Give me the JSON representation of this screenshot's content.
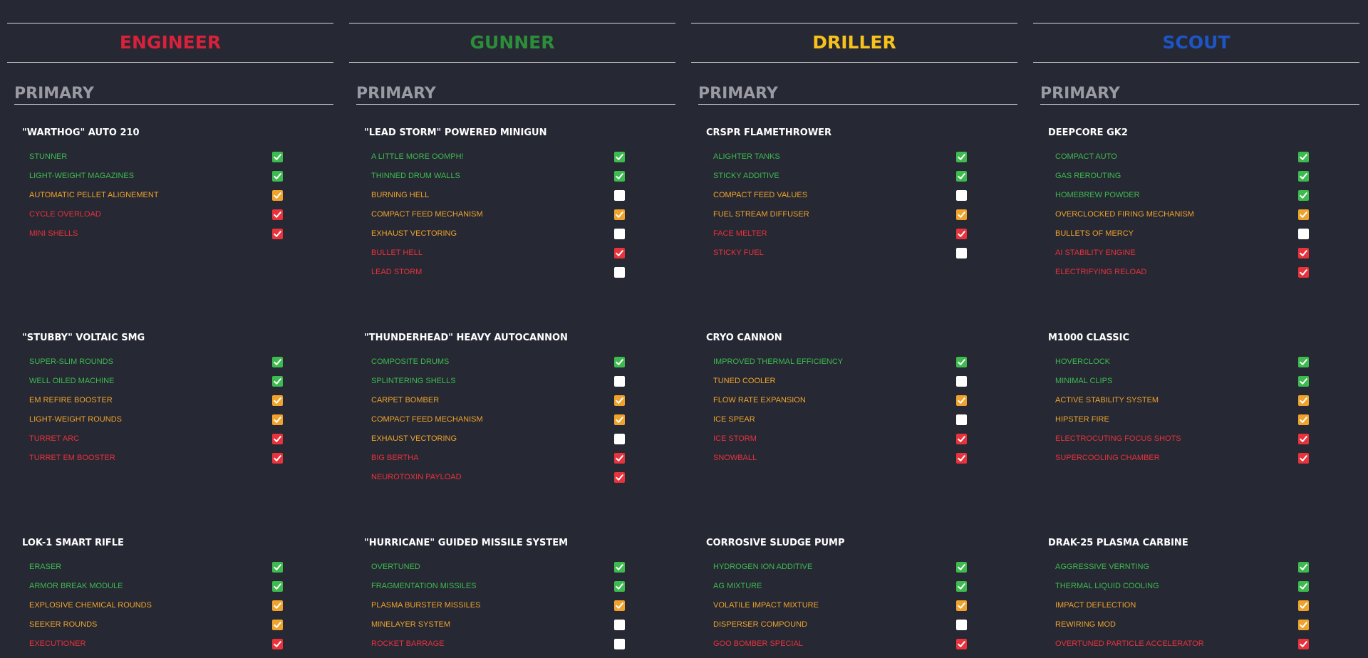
{
  "colors": {
    "green": "#3dbb4f",
    "orange": "#f0a32c",
    "red": "#e8323c",
    "white": "#ffffff",
    "engineer": "#d8213a",
    "gunner": "#2c8d3a",
    "driller": "#f7c21b",
    "scout": "#1d55c4"
  },
  "classes": [
    {
      "name": "ENGINEER",
      "color": "#d8213a",
      "section": "PRIMARY",
      "weapons": [
        {
          "name": "\"WARTHOG\" AUTO 210",
          "mods": [
            {
              "label": "STUNNER",
              "color": "green",
              "checked": true
            },
            {
              "label": "LIGHT-WEIGHT MAGAZINES",
              "color": "green",
              "checked": true
            },
            {
              "label": "AUTOMATIC PELLET ALIGNEMENT",
              "color": "orange",
              "checked": true
            },
            {
              "label": "CYCLE OVERLOAD",
              "color": "red",
              "checked": true
            },
            {
              "label": "MINI SHELLS",
              "color": "red",
              "checked": true
            }
          ]
        },
        {
          "name": "\"STUBBY\" VOLTAIC SMG",
          "mods": [
            {
              "label": "SUPER-SLIM ROUNDS",
              "color": "green",
              "checked": true
            },
            {
              "label": "WELL OILED MACHINE",
              "color": "green",
              "checked": true
            },
            {
              "label": "EM REFIRE BOOSTER",
              "color": "orange",
              "checked": true
            },
            {
              "label": "LIGHT-WEIGHT ROUNDS",
              "color": "orange",
              "checked": true
            },
            {
              "label": "TURRET ARC",
              "color": "red",
              "checked": true
            },
            {
              "label": "TURRET EM BOOSTER",
              "color": "red",
              "checked": true
            }
          ]
        },
        {
          "name": "LOK-1 SMART RIFLE",
          "mods": [
            {
              "label": "ERASER",
              "color": "green",
              "checked": true
            },
            {
              "label": "ARMOR BREAK MODULE",
              "color": "green",
              "checked": true
            },
            {
              "label": "EXPLOSIVE CHEMICAL ROUNDS",
              "color": "orange",
              "checked": true
            },
            {
              "label": "SEEKER ROUNDS",
              "color": "orange",
              "checked": true
            },
            {
              "label": "EXECUTIONER",
              "color": "red",
              "checked": true
            }
          ]
        }
      ]
    },
    {
      "name": "GUNNER",
      "color": "#2c8d3a",
      "section": "PRIMARY",
      "weapons": [
        {
          "name": "\"LEAD STORM\" POWERED MINIGUN",
          "mods": [
            {
              "label": "A LITTLE MORE OOMPH!",
              "color": "green",
              "checked": true
            },
            {
              "label": "THINNED DRUM WALLS",
              "color": "green",
              "checked": true
            },
            {
              "label": "BURNING HELL",
              "color": "orange",
              "checked": false
            },
            {
              "label": "COMPACT FEED MECHANISM",
              "color": "orange",
              "checked": true
            },
            {
              "label": "EXHAUST VECTORING",
              "color": "orange",
              "checked": false
            },
            {
              "label": "BULLET HELL",
              "color": "red",
              "checked": true
            },
            {
              "label": "LEAD STORM",
              "color": "red",
              "checked": false
            }
          ]
        },
        {
          "name": "\"THUNDERHEAD\" HEAVY AUTOCANNON",
          "mods": [
            {
              "label": "COMPOSITE DRUMS",
              "color": "green",
              "checked": true
            },
            {
              "label": "SPLINTERING SHELLS",
              "color": "green",
              "checked": false
            },
            {
              "label": "CARPET BOMBER",
              "color": "orange",
              "checked": true
            },
            {
              "label": "COMPACT FEED MECHANISM",
              "color": "orange",
              "checked": true
            },
            {
              "label": "EXHAUST VECTORING",
              "color": "orange",
              "checked": false
            },
            {
              "label": "BIG BERTHA",
              "color": "red",
              "checked": true
            },
            {
              "label": "NEUROTOXIN PAYLOAD",
              "color": "red",
              "checked": true
            }
          ]
        },
        {
          "name": "\"HURRICANE\" GUIDED MISSILE SYSTEM",
          "mods": [
            {
              "label": "OVERTUNED",
              "color": "green",
              "checked": true
            },
            {
              "label": "FRAGMENTATION MISSILES",
              "color": "green",
              "checked": true
            },
            {
              "label": "PLASMA BURSTER MISSILES",
              "color": "orange",
              "checked": true
            },
            {
              "label": "MINELAYER SYSTEM",
              "color": "orange",
              "checked": false
            },
            {
              "label": "ROCKET BARRAGE",
              "color": "red",
              "checked": false
            }
          ]
        }
      ]
    },
    {
      "name": "DRILLER",
      "color": "#f7c21b",
      "section": "PRIMARY",
      "weapons": [
        {
          "name": "CRSPR FLAMETHROWER",
          "mods": [
            {
              "label": "ALIGHTER TANKS",
              "color": "green",
              "checked": true
            },
            {
              "label": "STICKY ADDITIVE",
              "color": "green",
              "checked": true
            },
            {
              "label": "COMPACT FEED VALUES",
              "color": "orange",
              "checked": false
            },
            {
              "label": "FUEL STREAM DIFFUSER",
              "color": "orange",
              "checked": true
            },
            {
              "label": "FACE MELTER",
              "color": "red",
              "checked": true
            },
            {
              "label": "STICKY FUEL",
              "color": "red",
              "checked": false
            }
          ]
        },
        {
          "name": "CRYO CANNON",
          "mods": [
            {
              "label": "IMPROVED THERMAL EFFICIENCY",
              "color": "green",
              "checked": true
            },
            {
              "label": "TUNED COOLER",
              "color": "orange",
              "checked": false
            },
            {
              "label": "FLOW RATE EXPANSION",
              "color": "orange",
              "checked": true
            },
            {
              "label": "ICE SPEAR",
              "color": "orange",
              "checked": false
            },
            {
              "label": "ICE STORM",
              "color": "red",
              "checked": true
            },
            {
              "label": "SNOWBALL",
              "color": "red",
              "checked": true
            }
          ]
        },
        {
          "name": "CORROSIVE SLUDGE PUMP",
          "mods": [
            {
              "label": "HYDROGEN ION ADDITIVE",
              "color": "green",
              "checked": true
            },
            {
              "label": "AG MIXTURE",
              "color": "green",
              "checked": true
            },
            {
              "label": "VOLATILE IMPACT MIXTURE",
              "color": "orange",
              "checked": true
            },
            {
              "label": "DISPERSER COMPOUND",
              "color": "orange",
              "checked": false
            },
            {
              "label": "GOO BOMBER SPECIAL",
              "color": "red",
              "checked": true
            }
          ]
        }
      ]
    },
    {
      "name": "SCOUT",
      "color": "#1d55c4",
      "section": "PRIMARY",
      "weapons": [
        {
          "name": "DEEPCORE GK2",
          "mods": [
            {
              "label": "COMPACT AUTO",
              "color": "green",
              "checked": true
            },
            {
              "label": "GAS REROUTING",
              "color": "green",
              "checked": true
            },
            {
              "label": "HOMEBREW POWDER",
              "color": "green",
              "checked": true
            },
            {
              "label": "OVERCLOCKED FIRING MECHANISM",
              "color": "orange",
              "checked": true
            },
            {
              "label": "BULLETS OF MERCY",
              "color": "orange",
              "checked": false
            },
            {
              "label": "AI STABILITY ENGINE",
              "color": "red",
              "checked": true
            },
            {
              "label": "ELECTRIFYING RELOAD",
              "color": "red",
              "checked": true
            }
          ]
        },
        {
          "name": "M1000 CLASSIC",
          "mods": [
            {
              "label": "HOVERCLOCK",
              "color": "green",
              "checked": true
            },
            {
              "label": "MINIMAL CLIPS",
              "color": "green",
              "checked": true
            },
            {
              "label": "ACTIVE STABILITY SYSTEM",
              "color": "orange",
              "checked": true
            },
            {
              "label": "HIPSTER FIRE",
              "color": "orange",
              "checked": true
            },
            {
              "label": "ELECTROCUTING FOCUS SHOTS",
              "color": "red",
              "checked": true
            },
            {
              "label": "SUPERCOOLING CHAMBER",
              "color": "red",
              "checked": true
            }
          ]
        },
        {
          "name": "DRAK-25 PLASMA CARBINE",
          "mods": [
            {
              "label": "AGGRESSIVE VERNTING",
              "color": "green",
              "checked": true
            },
            {
              "label": "THERMAL LIQUID COOLING",
              "color": "green",
              "checked": true
            },
            {
              "label": "IMPACT DEFLECTION",
              "color": "orange",
              "checked": true
            },
            {
              "label": "REWIRING MOD",
              "color": "orange",
              "checked": true
            },
            {
              "label": "OVERTUNED PARTICLE ACCELERATOR",
              "color": "red",
              "checked": true
            }
          ]
        }
      ]
    }
  ]
}
